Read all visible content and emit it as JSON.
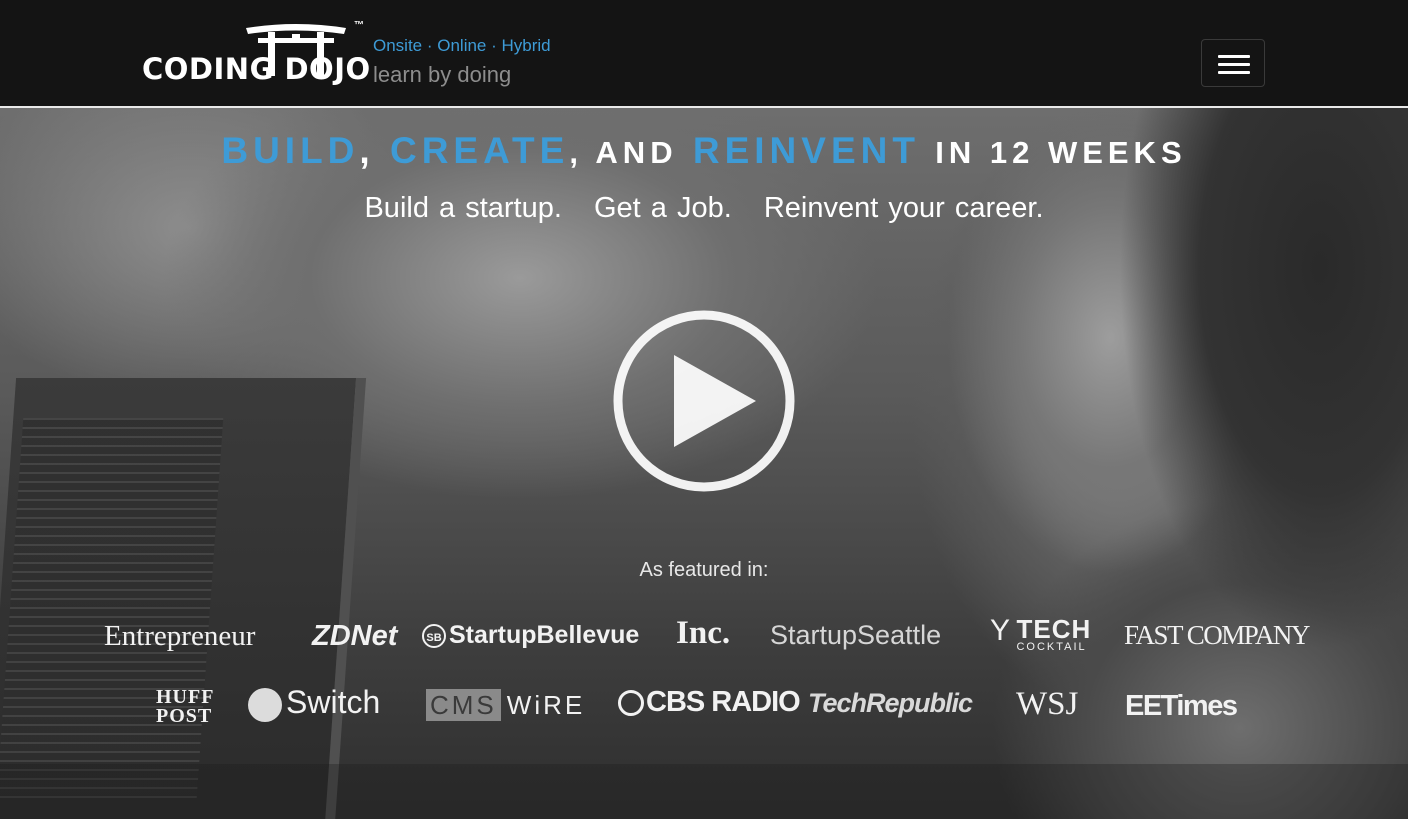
{
  "header": {
    "brand": "CODING DOJO",
    "trademark": "™",
    "tagline_top": "Onsite · Online · Hybrid",
    "tagline_bottom": "learn by doing",
    "menu_icon": "hamburger-icon"
  },
  "hero": {
    "title_parts": {
      "build": "BUILD",
      "comma1": ",",
      "create": "CREATE",
      "and": ", AND",
      "reinvent": "REINVENT",
      "tail": "IN 12 WEEKS"
    },
    "subtitle_parts": [
      "Build a startup.",
      "Get a Job.",
      "Reinvent your career."
    ],
    "play_icon": "play-icon",
    "featured_label": "As featured in:"
  },
  "press_logos": {
    "row1": [
      "Entrepreneur",
      "ZDNet",
      "StartupBellevue",
      "Inc.",
      "StartupSeattle",
      "TECH",
      "COCKTAIL",
      "FAST COMPANY"
    ],
    "row2": [
      "HUFF",
      "POST",
      "Switch",
      "CMS",
      "WiRE",
      "CBS RADIO",
      "TechRepublic",
      "WSJ",
      "EETimes"
    ]
  },
  "colors": {
    "accent": "#3e9bd6",
    "header_bg": "#141414",
    "text": "#ffffff"
  }
}
